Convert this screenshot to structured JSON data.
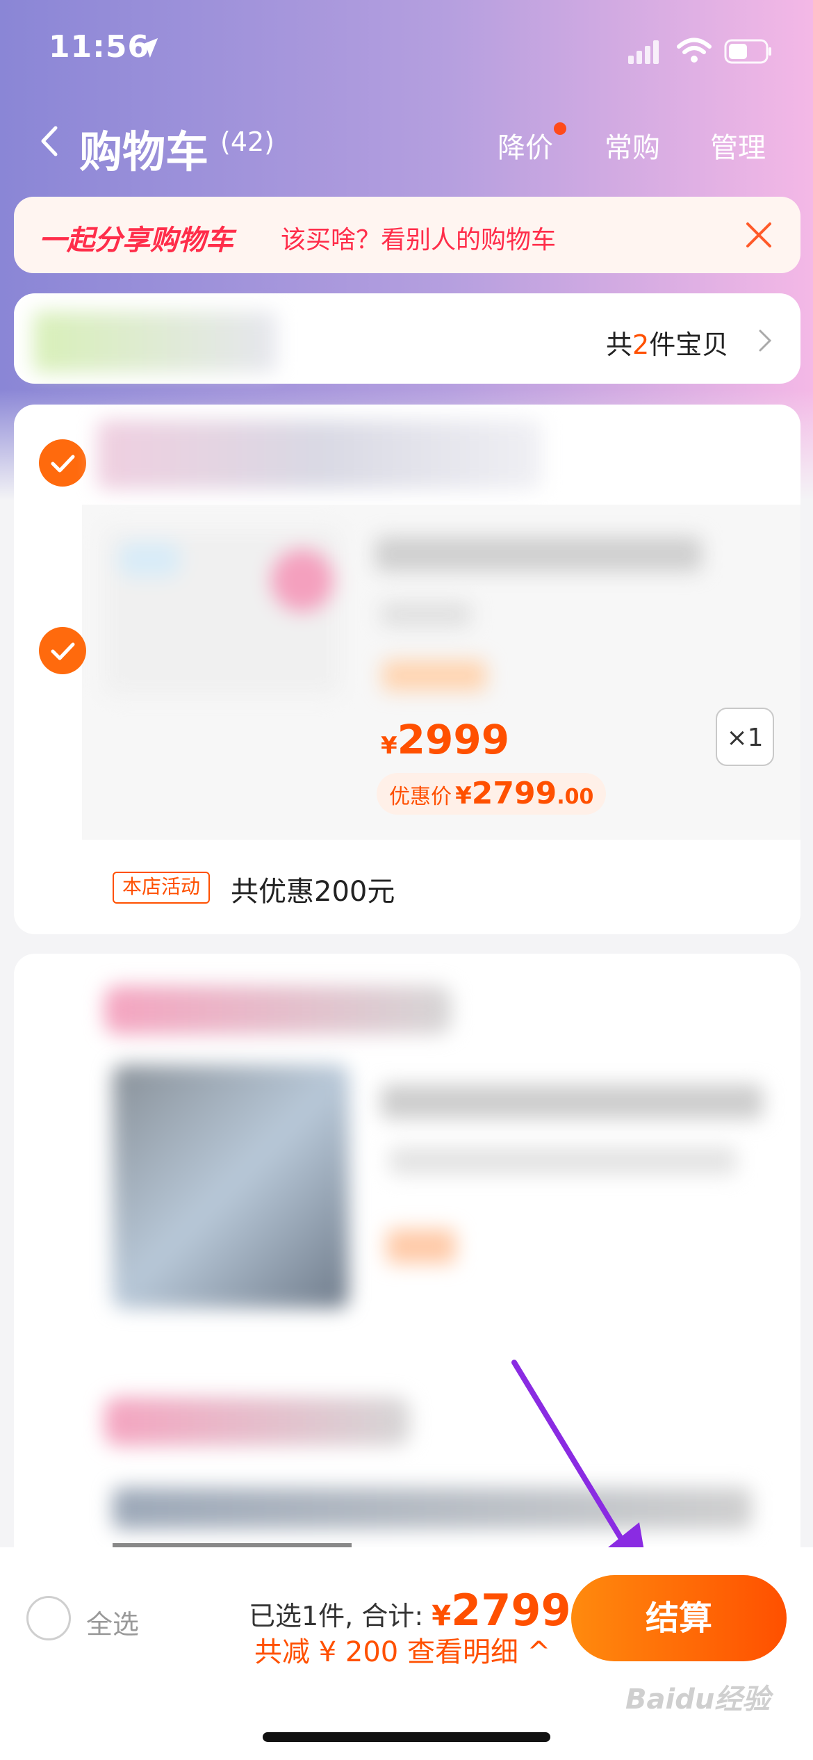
{
  "status": {
    "time": "11:56"
  },
  "nav": {
    "title": "购物车",
    "count": "(42)",
    "price_drop": "降价",
    "frequent": "常购",
    "manage": "管理"
  },
  "banner": {
    "title": "一起分享购物车",
    "text": "该买啥？看别人的购物车"
  },
  "store_summary": {
    "prefix": "共",
    "num": "2",
    "suffix": "件宝贝"
  },
  "item": {
    "price_yen": "¥",
    "price": "2999",
    "qty": "×1",
    "deal_label": "优惠价",
    "deal_yen": "¥",
    "deal_int": "2799",
    "deal_dec": ".00",
    "promo_tag": "本店活动",
    "promo_text": "共优惠200元"
  },
  "bottom": {
    "select_all": "全选",
    "selected_text": "已选1件, 合计:",
    "total_yen": "¥",
    "total": "2799",
    "savings_text": "共减 ¥ 200  查看明细 ^",
    "checkout": "结算",
    "watermark": "Baidu经验"
  },
  "colors": {
    "accent": "#ff5000",
    "banner_red": "#ff2d4a",
    "arrow": "#8a2be2"
  }
}
